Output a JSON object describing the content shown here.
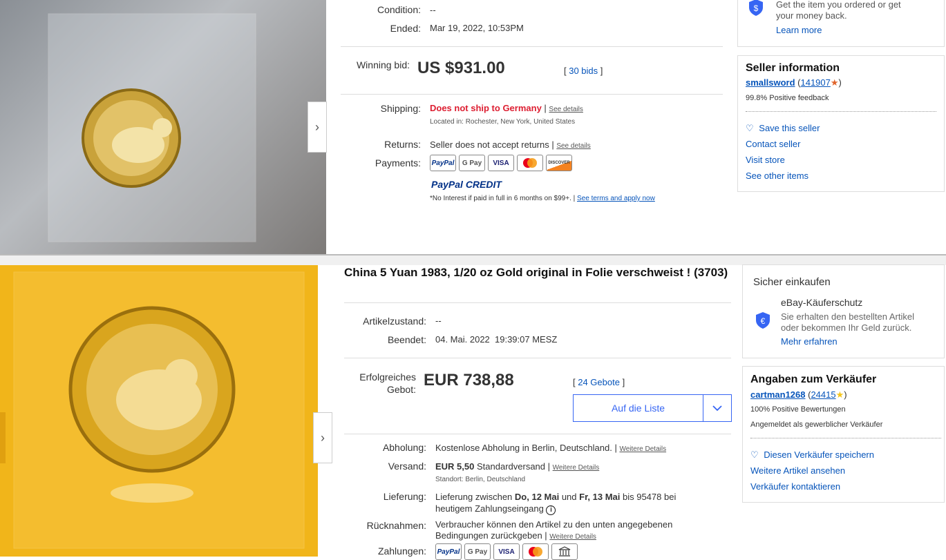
{
  "top": {
    "condition_label": "Condition:",
    "condition_value": "--",
    "ended_label": "Ended:",
    "ended_value": "Mar 19, 2022, 10:53PM",
    "winning_label": "Winning bid:",
    "winning_price": "US $931.00",
    "bids": "30 bids",
    "shipping_label": "Shipping:",
    "shipping_value": "Does not ship to Germany",
    "see_details": "See details",
    "located": "Located in: Rochester, New York, United States",
    "returns_label": "Returns:",
    "returns_value": "Seller does not accept returns",
    "payments_label": "Payments:",
    "paypal_credit": "PayPal CREDIT",
    "credit_note": "*No Interest if paid in full in 6 months on $99+.",
    "credit_link": "See terms and apply now",
    "guarantee_line1": "Get the item you ordered or get",
    "guarantee_line2": "your money back.",
    "learn_more": "Learn more",
    "seller_heading": "Seller information",
    "seller_name": "smallsword",
    "seller_score": "141907",
    "seller_feedback": "99.8% Positive feedback",
    "save_seller": "Save this seller",
    "contact_seller": "Contact seller",
    "visit_store": "Visit store",
    "other_items": "See other items",
    "payment_icons": [
      "PayPal",
      "G Pay",
      "VISA",
      "MC",
      "DISCOVER"
    ]
  },
  "bottom": {
    "title": "China 5 Yuan 1983, 1/20 oz Gold original in Folie verschweist ! (3703)",
    "zustand_label": "Artikelzustand:",
    "zustand_value": "--",
    "beendet_label": "Beendet:",
    "beendet_value": "04. Mai. 2022  19:39:07 MESZ",
    "gebot_label_1": "Erfolgreiches",
    "gebot_label_2": "Gebot:",
    "price": "EUR 738,88",
    "gebote": "24 Gebote",
    "watch_button": "Auf die Liste",
    "abholung_label": "Abholung:",
    "abholung_value": "Kostenlose Abholung in Berlin, Deutschland.",
    "weitere": "Weitere Details",
    "versand_label": "Versand:",
    "versand_price": "EUR 5,50",
    "versand_type": "Standardversand",
    "standort": "Standort: Berlin, Deutschland",
    "lieferung_label": "Lieferung:",
    "lieferung_1a": "Lieferung zwischen ",
    "lieferung_d1": "Do, 12 Mai",
    "lieferung_und": " und ",
    "lieferung_d2": "Fr, 13 Mai",
    "lieferung_1b": " bis 95478 bei",
    "lieferung_2": "heutigem Zahlungseingang",
    "ruecknahmen_label": "Rücknahmen:",
    "ruecknahmen_1": "Verbraucher können den Artikel zu den unten angegebenen",
    "ruecknahmen_2": "Bedingungen zurückgeben",
    "zahlungen_label": "Zahlungen:",
    "sicher": "Sicher einkaufen",
    "schutz": "eBay-Käuferschutz",
    "schutz_1": "Sie erhalten den bestellten Artikel",
    "schutz_2": "oder bekommen Ihr Geld zurück.",
    "mehr": "Mehr erfahren",
    "seller_heading": "Angaben zum Verkäufer",
    "seller_name": "cartman1268",
    "seller_score": "24415",
    "bewertungen": "100% Positive Bewertungen",
    "gewerblich": "Angemeldet als gewerblicher Verkäufer",
    "speichern": "Diesen Verkäufer speichern",
    "weitere_artikel": "Weitere Artikel ansehen",
    "kontaktieren": "Verkäufer kontaktieren",
    "payment_icons": [
      "PayPal",
      "G Pay",
      "VISA",
      "MC",
      "Bank"
    ]
  }
}
